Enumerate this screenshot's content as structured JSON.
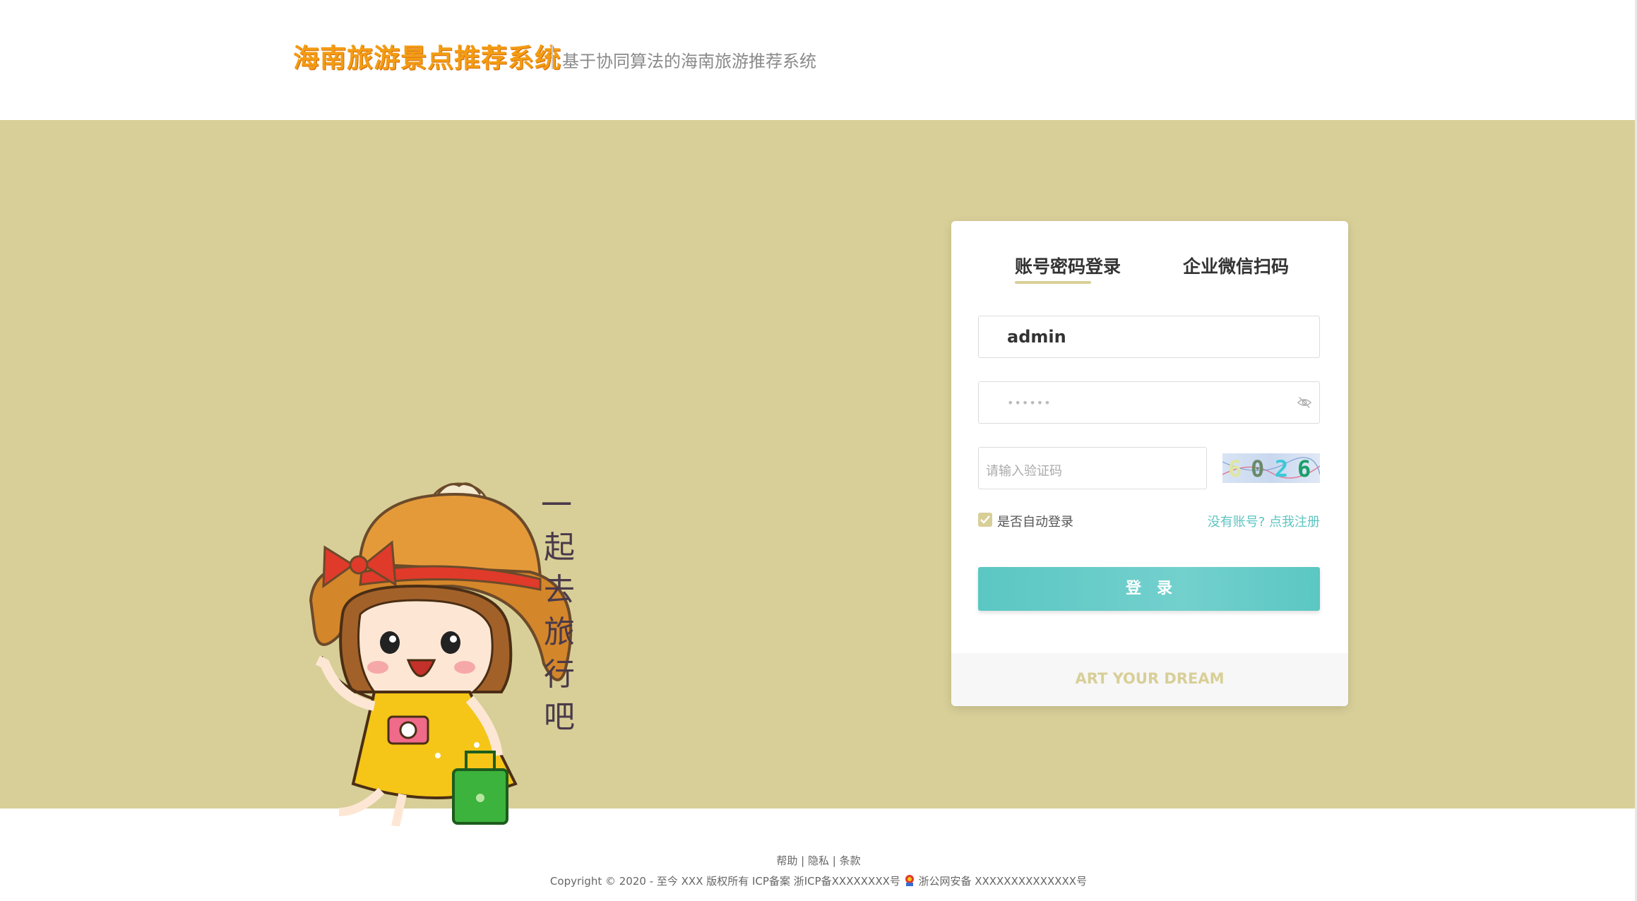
{
  "header": {
    "logo_text": "海南旅游景点推荐系统",
    "subtitle": "基于协同算法的海南旅游推荐系统"
  },
  "illustration": {
    "caption_chars": [
      "一",
      "起",
      "去",
      "旅",
      "行",
      "吧"
    ]
  },
  "login": {
    "tabs": [
      {
        "label": "账号密码登录",
        "active": true
      },
      {
        "label": "企业微信扫码",
        "active": false
      }
    ],
    "username": {
      "value": "admin"
    },
    "password": {
      "masked_value": "••••••"
    },
    "captcha": {
      "placeholder": "请输入验证码",
      "image_text": [
        "6",
        "0",
        "2",
        "6"
      ]
    },
    "remember_label": "是否自动登录",
    "remember_checked": true,
    "register_link": "没有账号? 点我注册",
    "submit_label": "登录",
    "footer_text": "ART YOUR DREAM"
  },
  "footer": {
    "links": [
      "帮助",
      "隐私",
      "条款"
    ],
    "separator": "|",
    "copyright": "Copyright © 2020 - 至今 XXX 版权所有 ICP备案 浙ICP备XXXXXXXX号",
    "police_record": "浙公网安备 XXXXXXXXXXXXXX号"
  },
  "colors": {
    "banner_bg": "#d8cf98",
    "accent_teal": "#5bc7c3",
    "logo_orange": "#f39c12"
  }
}
